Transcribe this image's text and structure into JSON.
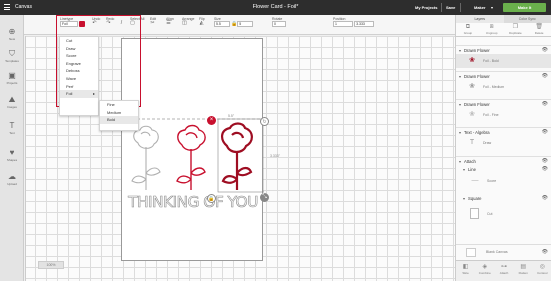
{
  "topbar": {
    "app_title": "Canvas",
    "document_title": "Flower Card - Foil*",
    "my_projects": "My Projects",
    "save": "Save",
    "machine": "Maker",
    "make_it": "Make It"
  },
  "toolbar": {
    "linetype_label": "Linetype",
    "linetype_value": "Foil",
    "undo_label": "Undo",
    "redo_label": "Redo",
    "select_all_label": "Select All",
    "edit_label": "Edit",
    "align_label": "Align",
    "arrange_label": "Arrange",
    "flip_label": "Flip",
    "size_label": "Size",
    "size_w_value": "5.5",
    "size_h_value": "5",
    "rotate_label": "Rotate",
    "rotate_value": "0",
    "position_label": "Position",
    "position_x_value": "1",
    "position_y_value": "3.333"
  },
  "linetype_menu": {
    "items": [
      "Cut",
      "Draw",
      "Score",
      "Engrave",
      "Deboss",
      "Wave",
      "Perf",
      "Foil"
    ],
    "foil_submenu": [
      "Fine",
      "Medium",
      "Bold"
    ],
    "selected": "Bold"
  },
  "left_sidebar": {
    "items": [
      "New",
      "Templates",
      "Projects",
      "Images",
      "Text",
      "Shapes",
      "Upload"
    ]
  },
  "canvas": {
    "width_dimension": "5.5\"",
    "height_dimension": "3.333\"",
    "card_text": "THINKING OF YOU",
    "zoom_value": "100%"
  },
  "layers_panel": {
    "tabs": [
      "Layers",
      "Color Sync"
    ],
    "actions": [
      "Group",
      "Ungroup",
      "Duplicate",
      "Delete"
    ],
    "layers": [
      {
        "name": "Drawn Flower",
        "sub": "Foil - Bold",
        "selected": true
      },
      {
        "name": "Drawn Flower",
        "sub": "Foil - Medium"
      },
      {
        "name": "Drawn Flower",
        "sub": "Foil - Fine"
      },
      {
        "name": "Text - Algebra",
        "sub": "Draw"
      },
      {
        "name": "Attach",
        "sub": ""
      },
      {
        "name": "Line",
        "sub": "Score"
      },
      {
        "name": "Square",
        "sub": "Cut"
      }
    ],
    "blank_canvas": "Blank Canvas",
    "footer_actions": [
      "Slice",
      "Combine",
      "Attach",
      "Flatten",
      "Contour"
    ]
  },
  "colors": {
    "accent_red": "#c8102e",
    "make_green": "#6ab04c",
    "topbar": "#2d2d2d"
  }
}
